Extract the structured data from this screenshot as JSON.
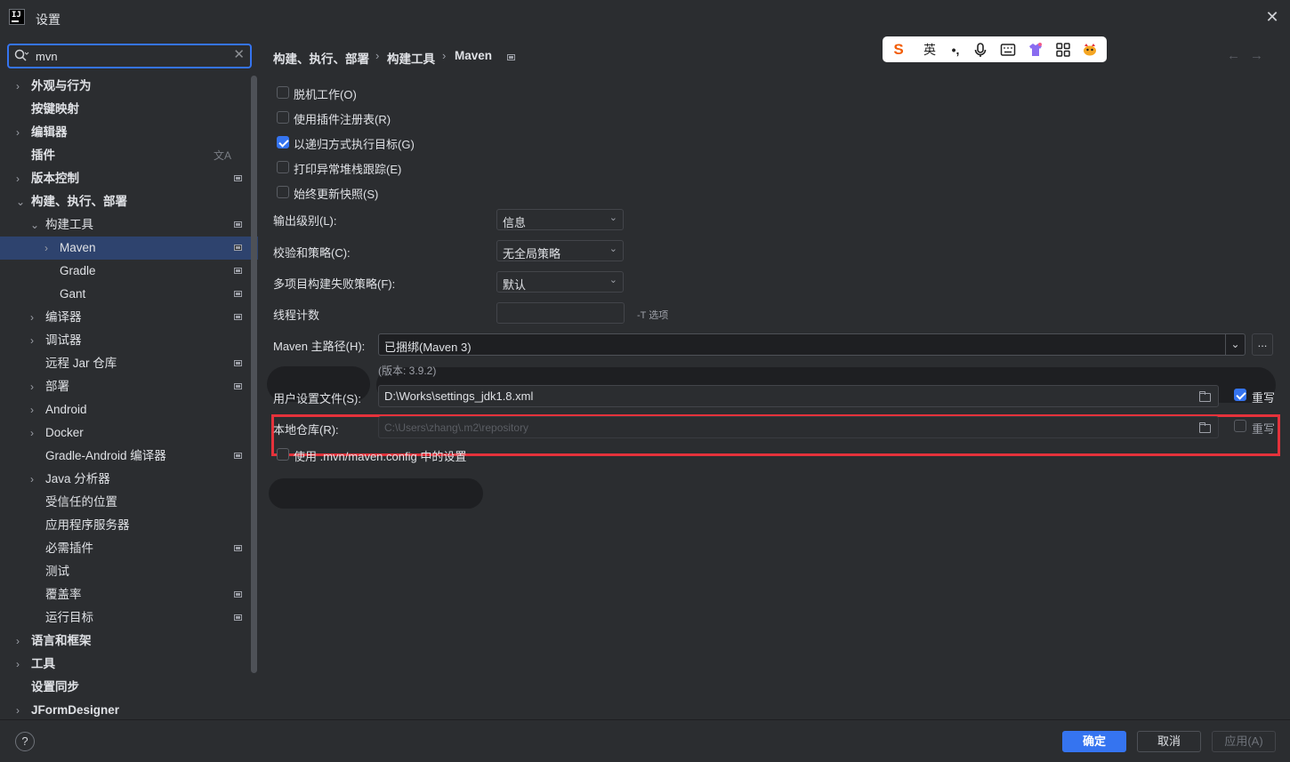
{
  "window": {
    "app_icon": "IJ",
    "title": "设置",
    "close": "✕"
  },
  "search": {
    "value": "mvn",
    "icon": "search-icon",
    "clear": "✕"
  },
  "sidebar": {
    "items": [
      {
        "label": "外观与行为",
        "chevron": "›",
        "bold": true
      },
      {
        "label": "按键映射",
        "bold": true
      },
      {
        "label": "编辑器",
        "chevron": "›",
        "bold": true
      },
      {
        "label": "插件",
        "bold": true,
        "translate": "文A"
      },
      {
        "label": "版本控制",
        "chevron": "›",
        "bold": true
      },
      {
        "label": "构建、执行、部署",
        "chevron": "⌄",
        "bold": true
      },
      {
        "label": "构建工具",
        "chevron": "⌄"
      },
      {
        "label": "Maven",
        "chevron": "›",
        "selected": true
      },
      {
        "label": "Gradle"
      },
      {
        "label": "Gant"
      },
      {
        "label": "编译器",
        "chevron": "›"
      },
      {
        "label": "调试器",
        "chevron": "›"
      },
      {
        "label": "远程 Jar 仓库"
      },
      {
        "label": "部署",
        "chevron": "›"
      },
      {
        "label": "Android",
        "chevron": "›"
      },
      {
        "label": "Docker",
        "chevron": "›"
      },
      {
        "label": "Gradle-Android 编译器"
      },
      {
        "label": "Java 分析器",
        "chevron": "›"
      },
      {
        "label": "受信任的位置"
      },
      {
        "label": "应用程序服务器"
      },
      {
        "label": "必需插件"
      },
      {
        "label": "测试"
      },
      {
        "label": "覆盖率"
      },
      {
        "label": "运行目标"
      },
      {
        "label": "语言和框架",
        "chevron": "›",
        "bold": true
      },
      {
        "label": "工具",
        "chevron": "›",
        "bold": true
      },
      {
        "label": "设置同步",
        "bold": true
      },
      {
        "label": "JFormDesigner",
        "chevron": "›",
        "bold": true
      }
    ]
  },
  "breadcrumb": {
    "items": [
      "构建、执行、部署",
      "构建工具",
      "Maven"
    ],
    "separator": "›",
    "back": "←",
    "forward": "→"
  },
  "ime": {
    "items": [
      "S",
      "英",
      "•,",
      "🎤",
      "⌨",
      "👕",
      "▦",
      "🦊"
    ]
  },
  "maven": {
    "checkboxes": [
      {
        "label": "脱机工作(O)",
        "checked": false
      },
      {
        "label": "使用插件注册表(R)",
        "checked": false
      },
      {
        "label": "以递归方式执行目标(G)",
        "checked": true
      },
      {
        "label": "打印异常堆栈跟踪(E)",
        "checked": false
      },
      {
        "label": "始终更新快照(S)",
        "checked": false
      }
    ],
    "output_level": {
      "label": "输出级别(L):",
      "value": "信息"
    },
    "checksum_policy": {
      "label": "校验和策略(C):",
      "value": "无全局策略"
    },
    "failure_policy": {
      "label": "多项目构建失败策略(F):",
      "value": "默认"
    },
    "thread_count": {
      "label": "线程计数",
      "value": "",
      "hint": "-T 选项"
    },
    "maven_home": {
      "label": "Maven 主路径(H):",
      "value": "已捆绑(Maven 3)",
      "version": "(版本: 3.9.2)",
      "more": "..."
    },
    "user_settings": {
      "label": "用户设置文件(S):",
      "value": "D:\\Works\\settings_jdk1.8.xml",
      "override_label": "重写",
      "override_checked": true
    },
    "local_repo": {
      "label": "本地仓库(R):",
      "placeholder": "C:\\Users\\zhang\\.m2\\repository",
      "override_label": "重写",
      "override_checked": false
    },
    "use_mvn_config": {
      "label": "使用 .mvn/maven.config 中的设置",
      "checked": false
    }
  },
  "footer": {
    "help": "?",
    "ok": "确定",
    "cancel": "取消",
    "apply": "应用(A)"
  },
  "colors": {
    "accent": "#3574f0",
    "highlight": "#e5323b",
    "selected_row": "#2e436e",
    "background": "#2b2d30"
  }
}
